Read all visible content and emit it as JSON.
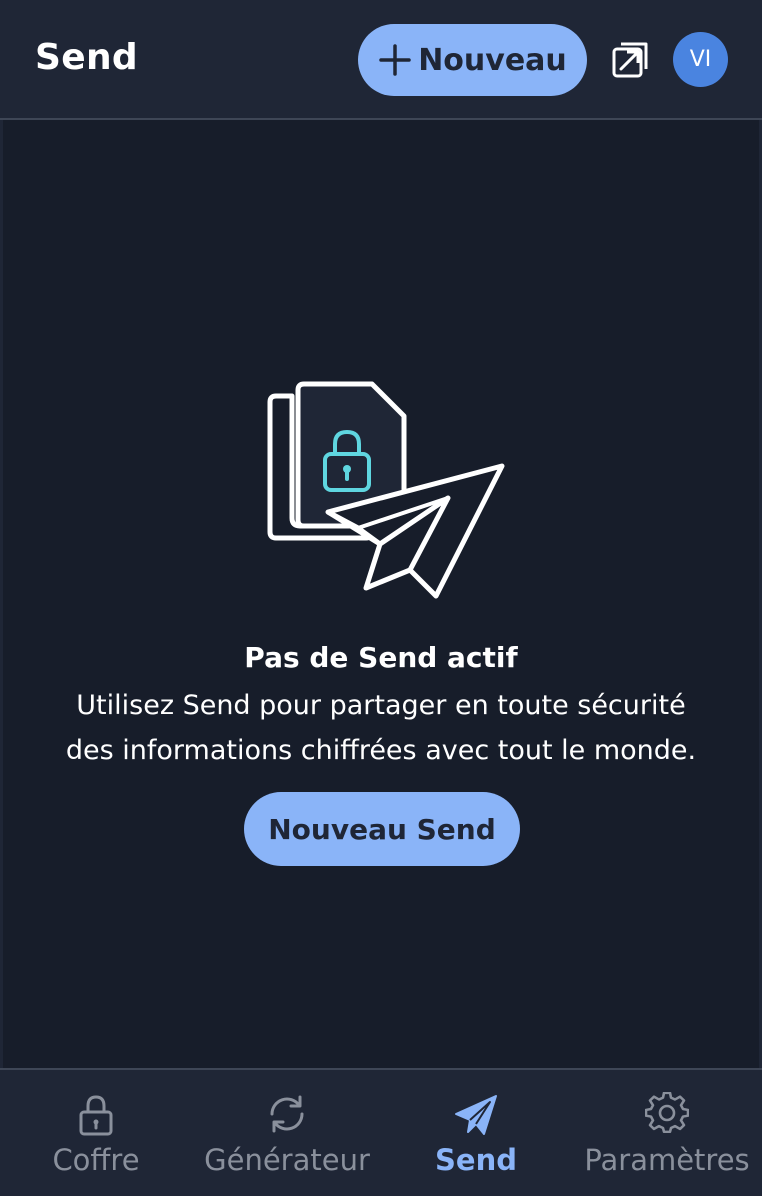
{
  "header": {
    "title": "Send",
    "new_button_label": "Nouveau",
    "avatar_initials": "VI"
  },
  "empty_state": {
    "title": "Pas de Send actif",
    "description_line1": "Utilisez Send pour partager en toute sécurité",
    "description_line2": "des informations chiffrées avec tout le monde.",
    "button_label": "Nouveau Send"
  },
  "nav": {
    "items": [
      {
        "label": "Coffre",
        "icon": "lock-icon",
        "active": false
      },
      {
        "label": "Générateur",
        "icon": "refresh-icon",
        "active": false
      },
      {
        "label": "Send",
        "icon": "paper-plane-icon",
        "active": true
      },
      {
        "label": "Paramètres",
        "icon": "gear-icon",
        "active": false
      }
    ]
  },
  "colors": {
    "header_bg": "#1f2636",
    "main_bg": "#171d2a",
    "accent": "#8ab4f8",
    "avatar": "#4a84e0",
    "nav_inactive": "#8a909c",
    "lock_accent": "#5fd6e0"
  }
}
